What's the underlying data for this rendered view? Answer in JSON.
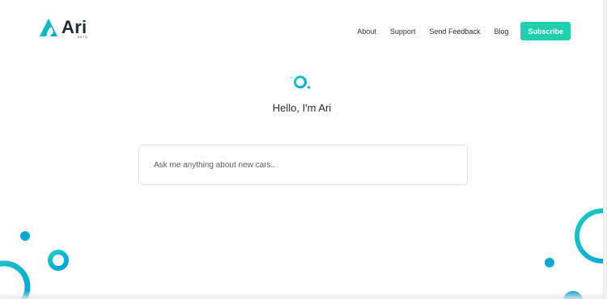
{
  "brand": {
    "name": "Ari",
    "badge": "BETA",
    "logo_icon": "triangle-logo-icon"
  },
  "nav": {
    "items": [
      {
        "label": "About"
      },
      {
        "label": "Support"
      },
      {
        "label": "Send Feedback"
      },
      {
        "label": "Blog"
      }
    ],
    "subscribe_label": "Subscribe"
  },
  "hero": {
    "icon": "ari-ring-icon",
    "greeting": "Hello, I'm Ari"
  },
  "search": {
    "placeholder": "Ask me anything about new cars..",
    "value": ""
  },
  "colors": {
    "accent": "#1ed0ae",
    "teal": "#0fb3c8",
    "blue": "#0aa0d6",
    "text": "#2b2f36"
  }
}
